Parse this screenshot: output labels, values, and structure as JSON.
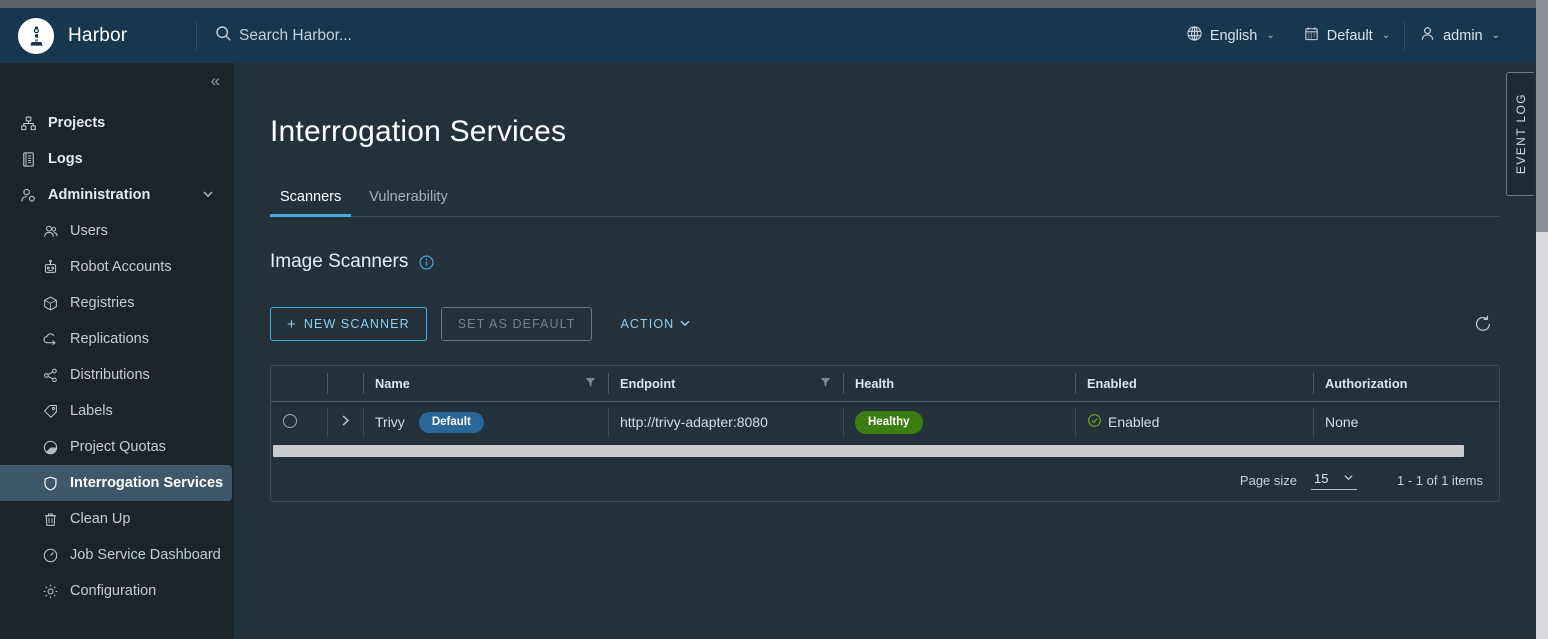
{
  "header": {
    "brand": "Harbor",
    "logo_icon": "harbor-lighthouse-logo",
    "search_placeholder": "Search Harbor...",
    "search_value": "",
    "search_icon": "search-icon",
    "language": "English",
    "language_icon": "globe-icon",
    "project": "Default",
    "project_icon": "calendar-icon",
    "user": "admin",
    "user_icon": "user-icon",
    "caret": "⌄"
  },
  "sidebar": {
    "collapse_icon": "«",
    "items": [
      {
        "label": "Projects",
        "icon": "projects-icon",
        "level": "top",
        "active": false
      },
      {
        "label": "Logs",
        "icon": "logs-icon",
        "level": "top",
        "active": false
      },
      {
        "label": "Administration",
        "icon": "administration-icon",
        "level": "top",
        "active": false,
        "expanded": true
      },
      {
        "label": "Users",
        "icon": "users-icon",
        "level": "sub",
        "active": false
      },
      {
        "label": "Robot Accounts",
        "icon": "robot-icon",
        "level": "sub",
        "active": false
      },
      {
        "label": "Registries",
        "icon": "registries-icon",
        "level": "sub",
        "active": false
      },
      {
        "label": "Replications",
        "icon": "replications-icon",
        "level": "sub",
        "active": false
      },
      {
        "label": "Distributions",
        "icon": "distributions-icon",
        "level": "sub",
        "active": false
      },
      {
        "label": "Labels",
        "icon": "labels-icon",
        "level": "sub",
        "active": false
      },
      {
        "label": "Project Quotas",
        "icon": "quotas-icon",
        "level": "sub",
        "active": false
      },
      {
        "label": "Interrogation Services",
        "icon": "shield-icon",
        "level": "sub",
        "active": true
      },
      {
        "label": "Clean Up",
        "icon": "trash-icon",
        "level": "sub",
        "active": false
      },
      {
        "label": "Job Service Dashboard",
        "icon": "gauge-icon",
        "level": "sub",
        "active": false
      },
      {
        "label": "Configuration",
        "icon": "gear-icon",
        "level": "sub",
        "active": false
      }
    ]
  },
  "main": {
    "page_title": "Interrogation Services",
    "tabs": [
      {
        "label": "Scanners",
        "active": true
      },
      {
        "label": "Vulnerability",
        "active": false
      }
    ],
    "section_title": "Image Scanners",
    "info_icon": "info-icon",
    "toolbar": {
      "new_scanner": "NEW SCANNER",
      "set_as_default": "SET AS DEFAULT",
      "action": "ACTION",
      "action_caret": "⌄",
      "refresh_icon": "refresh-icon"
    },
    "table": {
      "columns": [
        "Name",
        "Endpoint",
        "Health",
        "Enabled",
        "Authorization"
      ],
      "filter_icon": "filter-icon",
      "expand_icon": "chevron-right-icon",
      "select_icon": "radio-button",
      "rows": [
        {
          "name": "Trivy",
          "name_badge": "Default",
          "endpoint": "http://trivy-adapter:8080",
          "health": "Healthy",
          "enabled": "Enabled",
          "enabled_icon": "check-circle-icon",
          "authorization": "None"
        }
      ]
    },
    "pager": {
      "page_size_label": "Page size",
      "page_size_value": "15",
      "page_size_caret": "⌄",
      "count": "1 - 1 of 1 items"
    }
  },
  "event_log": {
    "label": "EVENT LOG"
  },
  "colors": {
    "accent": "#4aaae0",
    "header_bg": "#16374e",
    "sidebar_bg": "#1b2429",
    "content_bg": "#22313a",
    "active_nav_bg": "#3d586b",
    "badge_default_bg": "#2a6798",
    "badge_healthy_bg": "#3b7d10",
    "enabled_check": "#6fa726"
  }
}
